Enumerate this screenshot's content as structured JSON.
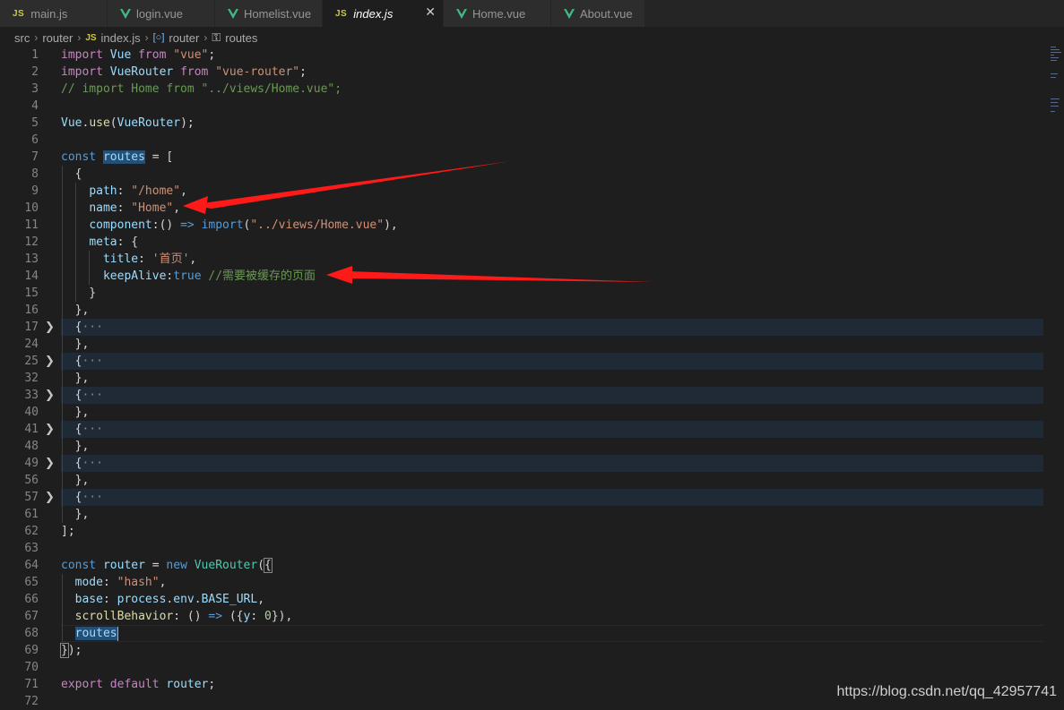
{
  "tabs": [
    {
      "label": "main.js",
      "type": "js"
    },
    {
      "label": "login.vue",
      "type": "vue"
    },
    {
      "label": "Homelist.vue",
      "type": "vue"
    },
    {
      "label": "index.js",
      "type": "js",
      "active": true,
      "close": "✕"
    },
    {
      "label": "Home.vue",
      "type": "vue"
    },
    {
      "label": "About.vue",
      "type": "vue"
    }
  ],
  "icons": {
    "js": "JS",
    "js_icon": "js-file-icon",
    "vue_icon": "vue-file-icon",
    "vue_color": "#41b883"
  },
  "breadcrumb": [
    "src",
    "router",
    "index.js",
    "router",
    "routes"
  ],
  "lines": [
    {
      "n": "1",
      "t": [
        [
          "ctl",
          "import"
        ],
        [
          "pun",
          " "
        ],
        [
          "var",
          "Vue"
        ],
        [
          "pun",
          " "
        ],
        [
          "ctl",
          "from"
        ],
        [
          "pun",
          " "
        ],
        [
          "str",
          "\"vue\""
        ],
        [
          "pun",
          ";"
        ]
      ]
    },
    {
      "n": "2",
      "t": [
        [
          "ctl",
          "import"
        ],
        [
          "pun",
          " "
        ],
        [
          "var",
          "VueRouter"
        ],
        [
          "pun",
          " "
        ],
        [
          "ctl",
          "from"
        ],
        [
          "pun",
          " "
        ],
        [
          "str",
          "\"vue-router\""
        ],
        [
          "pun",
          ";"
        ]
      ]
    },
    {
      "n": "3",
      "t": [
        [
          "cm",
          "// import Home from \"../views/Home.vue\";"
        ]
      ]
    },
    {
      "n": "4",
      "t": []
    },
    {
      "n": "5",
      "t": [
        [
          "var",
          "Vue"
        ],
        [
          "pun",
          "."
        ],
        [
          "fn",
          "use"
        ],
        [
          "pun",
          "("
        ],
        [
          "var",
          "VueRouter"
        ],
        [
          "pun",
          ");"
        ]
      ]
    },
    {
      "n": "6",
      "t": []
    },
    {
      "n": "7",
      "t": [
        [
          "kw",
          "const"
        ],
        [
          "pun",
          " "
        ],
        [
          "var sel",
          "routes"
        ],
        [
          "pun",
          " = ["
        ]
      ]
    },
    {
      "n": "8",
      "t": [
        [
          "pun",
          "  {"
        ]
      ]
    },
    {
      "n": "9",
      "t": [
        [
          "pun",
          "    "
        ],
        [
          "var",
          "path"
        ],
        [
          "pun",
          ": "
        ],
        [
          "str",
          "\"/home\""
        ],
        [
          "pun",
          ","
        ]
      ]
    },
    {
      "n": "10",
      "t": [
        [
          "pun",
          "    "
        ],
        [
          "var",
          "name"
        ],
        [
          "pun",
          ": "
        ],
        [
          "str",
          "\"Home\""
        ],
        [
          "pun",
          ","
        ]
      ]
    },
    {
      "n": "11",
      "t": [
        [
          "pun",
          "    "
        ],
        [
          "var",
          "component"
        ],
        [
          "pun",
          ":() "
        ],
        [
          "kw",
          "=>"
        ],
        [
          "pun",
          " "
        ],
        [
          "kw",
          "import"
        ],
        [
          "pun",
          "("
        ],
        [
          "str",
          "\"../views/Home.vue\""
        ],
        [
          "pun",
          "),"
        ]
      ]
    },
    {
      "n": "12",
      "t": [
        [
          "pun",
          "    "
        ],
        [
          "var",
          "meta"
        ],
        [
          "pun",
          ": {"
        ]
      ]
    },
    {
      "n": "13",
      "t": [
        [
          "pun",
          "      "
        ],
        [
          "var",
          "title"
        ],
        [
          "pun",
          ": "
        ],
        [
          "str",
          "'首页'"
        ],
        [
          "pun",
          ","
        ]
      ]
    },
    {
      "n": "14",
      "t": [
        [
          "pun",
          "      "
        ],
        [
          "var",
          "keepAlive"
        ],
        [
          "pun",
          ":"
        ],
        [
          "kw",
          "true"
        ],
        [
          "pun",
          " "
        ],
        [
          "cm",
          "//需要被缓存的页面"
        ]
      ]
    },
    {
      "n": "15",
      "t": [
        [
          "pun",
          "    }"
        ]
      ]
    },
    {
      "n": "16",
      "t": [
        [
          "pun",
          "  },"
        ]
      ]
    },
    {
      "n": "17",
      "fold": true,
      "t": [
        [
          "pun",
          "  {"
        ],
        [
          "ell",
          "···"
        ]
      ]
    },
    {
      "n": "24",
      "t": [
        [
          "pun",
          "  },"
        ]
      ]
    },
    {
      "n": "25",
      "fold": true,
      "t": [
        [
          "pun",
          "  {"
        ],
        [
          "ell",
          "···"
        ]
      ]
    },
    {
      "n": "32",
      "t": [
        [
          "pun",
          "  },"
        ]
      ]
    },
    {
      "n": "33",
      "fold": true,
      "t": [
        [
          "pun",
          "  {"
        ],
        [
          "ell",
          "···"
        ]
      ]
    },
    {
      "n": "40",
      "t": [
        [
          "pun",
          "  },"
        ]
      ]
    },
    {
      "n": "41",
      "fold": true,
      "t": [
        [
          "pun",
          "  {"
        ],
        [
          "ell",
          "···"
        ]
      ]
    },
    {
      "n": "48",
      "t": [
        [
          "pun",
          "  },"
        ]
      ]
    },
    {
      "n": "49",
      "fold": true,
      "t": [
        [
          "pun",
          "  {"
        ],
        [
          "ell",
          "···"
        ]
      ]
    },
    {
      "n": "56",
      "t": [
        [
          "pun",
          "  },"
        ]
      ]
    },
    {
      "n": "57",
      "fold": true,
      "t": [
        [
          "pun",
          "  {"
        ],
        [
          "ell",
          "···"
        ]
      ]
    },
    {
      "n": "61",
      "t": [
        [
          "pun",
          "  },"
        ]
      ]
    },
    {
      "n": "62",
      "t": [
        [
          "pun",
          "];"
        ]
      ]
    },
    {
      "n": "63",
      "t": []
    },
    {
      "n": "64",
      "t": [
        [
          "kw",
          "const"
        ],
        [
          "pun",
          " "
        ],
        [
          "var",
          "router"
        ],
        [
          "pun",
          " = "
        ],
        [
          "kw",
          "new"
        ],
        [
          "pun",
          " "
        ],
        [
          "cls",
          "VueRouter"
        ],
        [
          "pun",
          "("
        ],
        [
          "pun bm",
          "{"
        ]
      ]
    },
    {
      "n": "65",
      "t": [
        [
          "pun",
          "  "
        ],
        [
          "var",
          "mode"
        ],
        [
          "pun",
          ": "
        ],
        [
          "str",
          "\"hash\""
        ],
        [
          "pun",
          ","
        ]
      ]
    },
    {
      "n": "66",
      "t": [
        [
          "pun",
          "  "
        ],
        [
          "var",
          "base"
        ],
        [
          "pun",
          ": "
        ],
        [
          "var",
          "process"
        ],
        [
          "pun",
          "."
        ],
        [
          "var",
          "env"
        ],
        [
          "pun",
          "."
        ],
        [
          "var",
          "BASE_URL"
        ],
        [
          "pun",
          ","
        ]
      ]
    },
    {
      "n": "67",
      "t": [
        [
          "pun",
          "  "
        ],
        [
          "fn",
          "scrollBehavior"
        ],
        [
          "pun",
          ": () "
        ],
        [
          "kw",
          "=>"
        ],
        [
          "pun",
          " ({"
        ],
        [
          "var",
          "y"
        ],
        [
          "pun",
          ": "
        ],
        [
          "num",
          "0"
        ],
        [
          "pun",
          "}),"
        ]
      ]
    },
    {
      "n": "68",
      "cur": true,
      "t": [
        [
          "pun",
          "  "
        ],
        [
          "var sel",
          "routes"
        ]
      ]
    },
    {
      "n": "69",
      "t": [
        [
          "pun bm",
          "}"
        ],
        [
          "pun",
          ");"
        ]
      ]
    },
    {
      "n": "70",
      "t": []
    },
    {
      "n": "71",
      "t": [
        [
          "ctl",
          "export"
        ],
        [
          "pun",
          " "
        ],
        [
          "ctl",
          "default"
        ],
        [
          "pun",
          " "
        ],
        [
          "var",
          "router"
        ],
        [
          "pun",
          ";"
        ]
      ]
    },
    {
      "n": "72",
      "t": []
    }
  ],
  "watermark": "https://blog.csdn.net/qq_42957741",
  "arrow_color": "#ff1a1a"
}
